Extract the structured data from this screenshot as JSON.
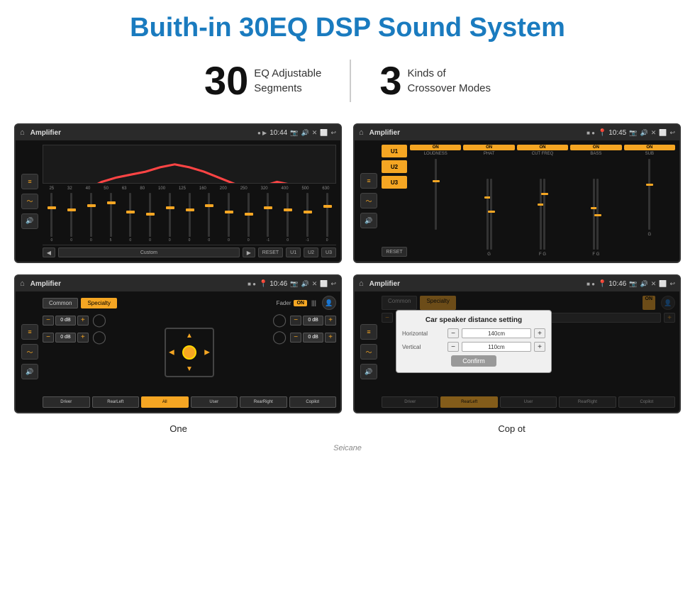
{
  "header": {
    "title": "Buith-in 30EQ DSP Sound System"
  },
  "stats": [
    {
      "number": "30",
      "text": "EQ Adjustable\nSegments"
    },
    {
      "number": "3",
      "text": "Kinds of\nCrossover Modes"
    }
  ],
  "screen1": {
    "bar": {
      "title": "Amplifier",
      "time": "10:44"
    },
    "freq_labels": [
      "25",
      "32",
      "40",
      "50",
      "63",
      "80",
      "100",
      "125",
      "160",
      "200",
      "250",
      "320",
      "400",
      "500",
      "630"
    ],
    "bottom_buttons": [
      "◀",
      "Custom",
      "▶",
      "RESET",
      "U1",
      "U2",
      "U3"
    ]
  },
  "screen2": {
    "bar": {
      "title": "Amplifier",
      "time": "10:45"
    },
    "channels": [
      "LOUDNESS",
      "PHAT",
      "CUT FREQ",
      "BASS",
      "SUB"
    ],
    "u_buttons": [
      "U1",
      "U2",
      "U3"
    ],
    "reset_label": "RESET"
  },
  "screen3": {
    "bar": {
      "title": "Amplifier",
      "time": "10:46"
    },
    "tabs": [
      "Common",
      "Specialty"
    ],
    "fader_label": "Fader",
    "on_label": "ON",
    "db_values": [
      "0 dB",
      "0 dB",
      "0 dB",
      "0 dB"
    ],
    "bottom_btns": [
      "Driver",
      "RearLeft",
      "All",
      "User",
      "RearRight",
      "Copilot"
    ]
  },
  "screen4": {
    "bar": {
      "title": "Amplifier",
      "time": "10:46"
    },
    "tabs": [
      "Common",
      "Specialty"
    ],
    "dialog": {
      "title": "Car speaker distance setting",
      "rows": [
        {
          "label": "Horizontal",
          "value": "140cm"
        },
        {
          "label": "Vertical",
          "value": "110cm"
        }
      ],
      "confirm_label": "Confirm"
    },
    "bottom_btns": [
      "Driver",
      "RearLeft",
      "User",
      "RearRight",
      "Copilot"
    ]
  },
  "watermark": "Seicane",
  "bottom_labels": {
    "one": "One",
    "copilot": "Cop ot"
  }
}
